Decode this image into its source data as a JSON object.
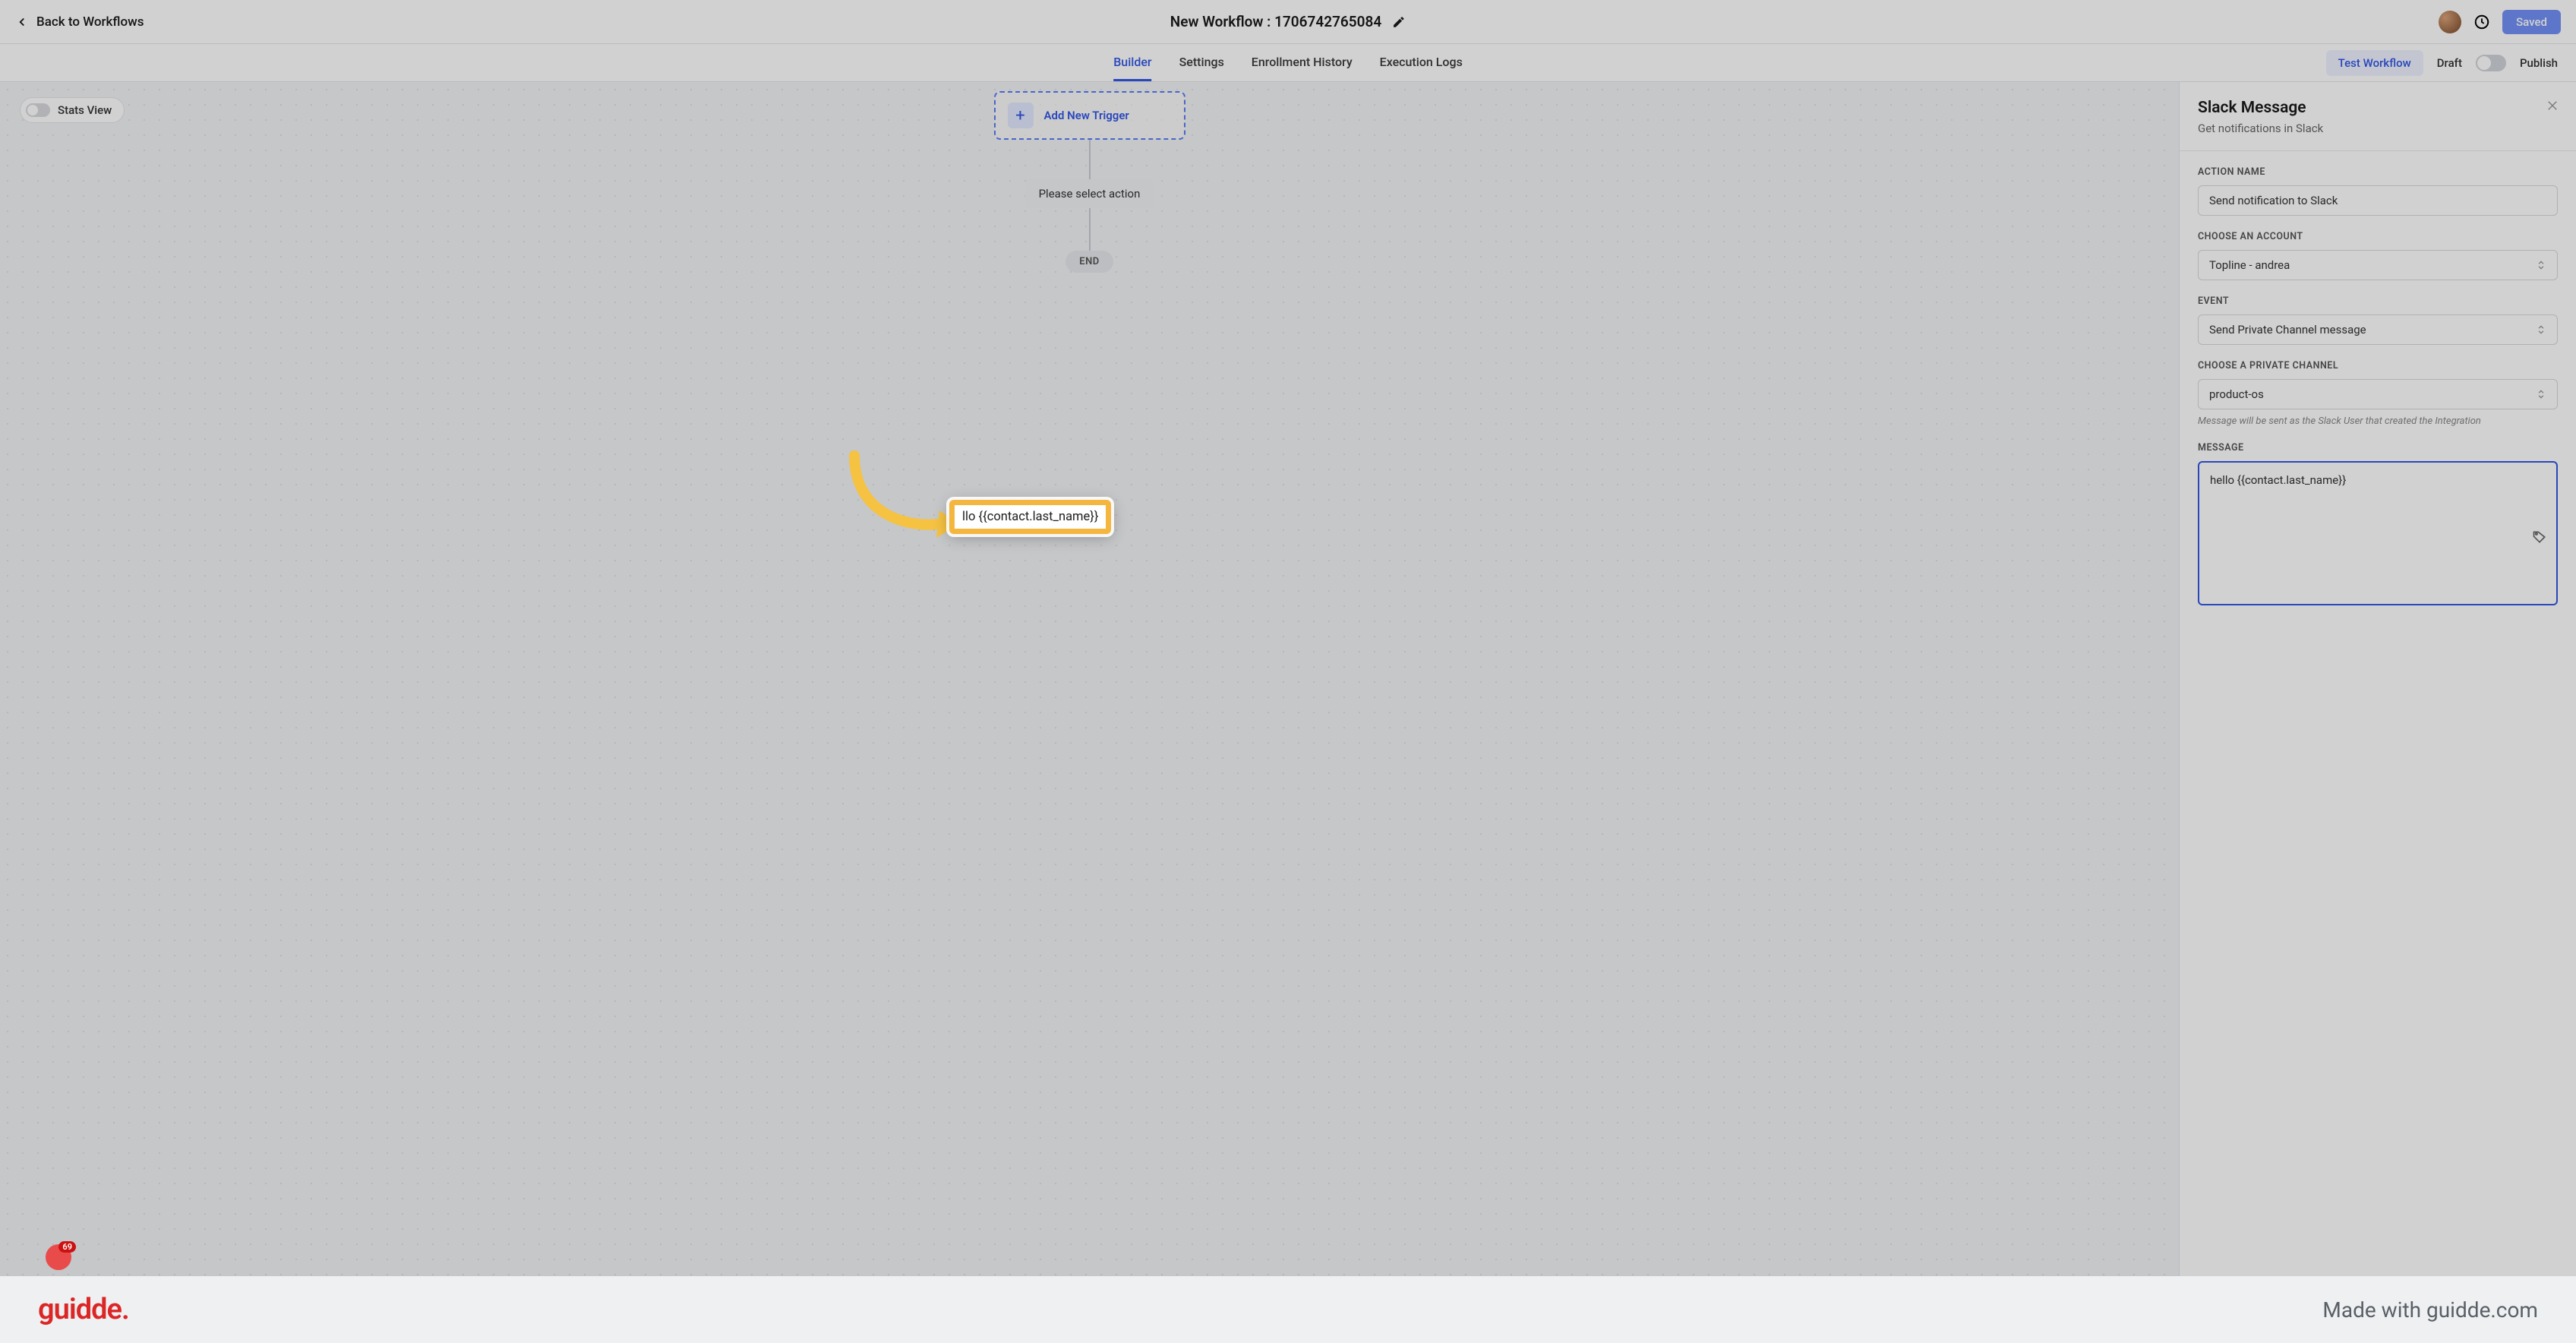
{
  "header": {
    "back_label": "Back to Workflows",
    "title": "New Workflow : 1706742765084",
    "saved_label": "Saved"
  },
  "tabs": {
    "items": [
      "Builder",
      "Settings",
      "Enrollment History",
      "Execution Logs"
    ],
    "active": "Builder",
    "test_label": "Test Workflow",
    "draft_label": "Draft",
    "publish_label": "Publish"
  },
  "canvas": {
    "stats_label": "Stats View",
    "trigger_label": "Add New Trigger",
    "action_prompt": "Please select action",
    "end_label": "END"
  },
  "panel": {
    "title": "Slack Message",
    "subtitle": "Get notifications in Slack",
    "action_name_label": "ACTION NAME",
    "action_name_value": "Send notification to Slack",
    "account_label": "CHOOSE AN ACCOUNT",
    "account_value": "Topline - andrea",
    "event_label": "EVENT",
    "event_value": "Send Private Channel message",
    "channel_label": "CHOOSE A PRIVATE CHANNEL",
    "channel_value": "product-os",
    "channel_helper": "Message will be sent as the Slack User that created the Integration",
    "message_label": "MESSAGE",
    "message_value": "hello {{contact.last_name}}"
  },
  "callout": {
    "text": "llo {{contact.last_name}}"
  },
  "footer": {
    "brand": "guidde",
    "madewith": "Made with guidde.com"
  },
  "badge": {
    "count": "69"
  }
}
